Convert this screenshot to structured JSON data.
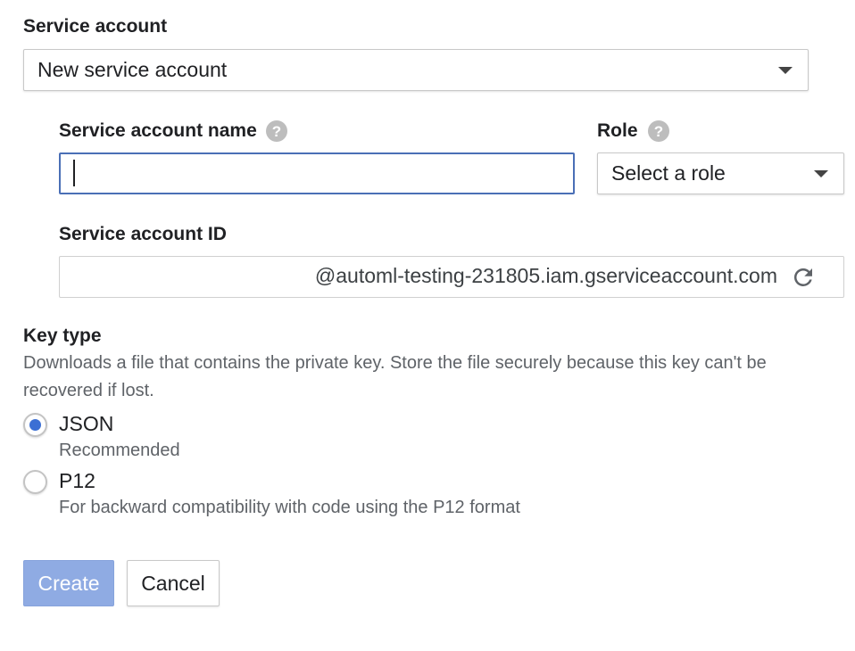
{
  "service_account": {
    "label": "Service account",
    "selected": "New service account"
  },
  "name_field": {
    "label": "Service account name",
    "value": ""
  },
  "role": {
    "label": "Role",
    "selected": "Select a role"
  },
  "account_id": {
    "label": "Service account ID",
    "suffix": "@automl-testing-231805.iam.gserviceaccount.com"
  },
  "key_type": {
    "label": "Key type",
    "description": "Downloads a file that contains the private key. Store the file securely because this key can't be recovered if lost.",
    "options": [
      {
        "label": "JSON",
        "sublabel": "Recommended",
        "checked": true
      },
      {
        "label": "P12",
        "sublabel": "For backward compatibility with code using the P12 format",
        "checked": false
      }
    ]
  },
  "actions": {
    "create_label": "Create",
    "cancel_label": "Cancel"
  },
  "icons": {
    "help": "help-icon",
    "refresh": "refresh-icon",
    "dropdown": "chevron-down-icon"
  },
  "colors": {
    "accent": "#3b6fd4",
    "primary_button_disabled": "#8fabe3",
    "focus_border": "#4a6fb6"
  }
}
